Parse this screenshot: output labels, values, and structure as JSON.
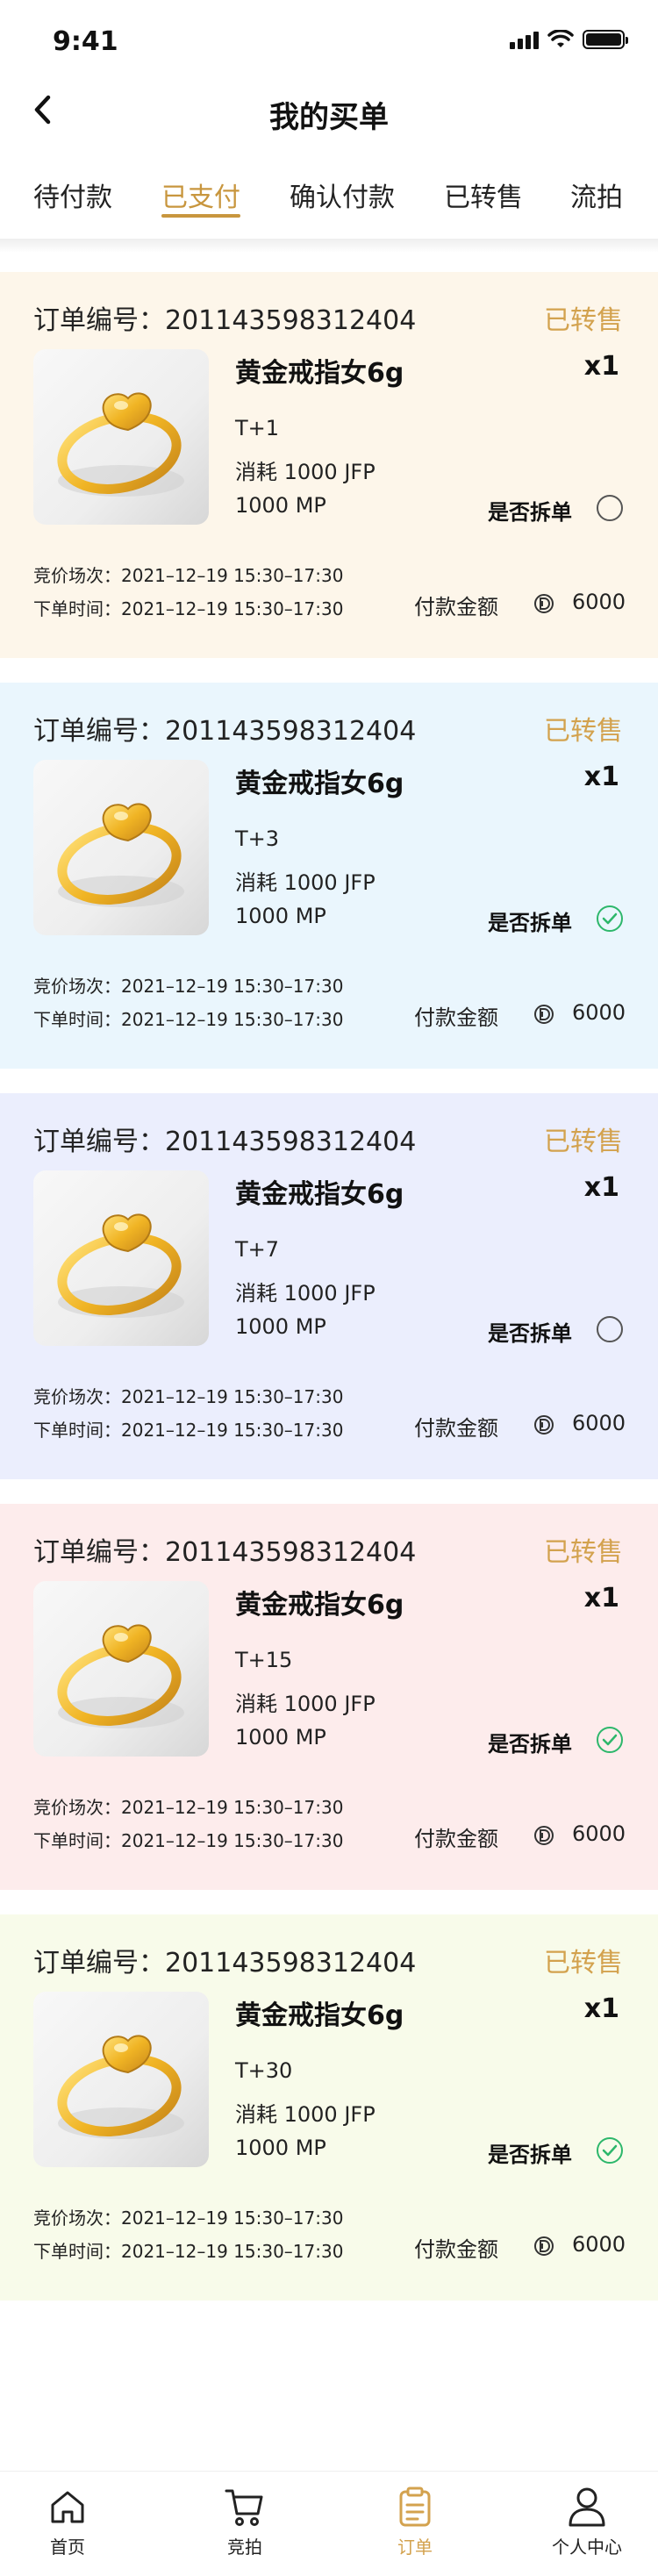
{
  "status_bar": {
    "time": "9:41"
  },
  "header": {
    "title": "我的买单"
  },
  "tabs": [
    {
      "label": "待付款",
      "active": false
    },
    {
      "label": "已支付",
      "active": true
    },
    {
      "label": "确认付款",
      "active": false
    },
    {
      "label": "已转售",
      "active": false
    },
    {
      "label": "流拍",
      "active": false
    }
  ],
  "colors": {
    "accent": "#c8963e",
    "status": "#d3a24e",
    "check": "#2db76b"
  },
  "orders": [
    {
      "order_label": "订单编号：201143598312404",
      "status": "已转售",
      "product": "黄金戒指女6g",
      "qty": "x1",
      "t": "T+1",
      "consume": "消耗 1000 JFP",
      "mp": "1000 MP",
      "split_label": "是否拆单",
      "split_checked": false,
      "session": "竞价场次：2021–12–19 15:30–17:30",
      "order_time": "下单时间：2021–12–19 15:30–17:30",
      "pay_label": "付款金额",
      "pay_amount": "6000",
      "bg": "#fdf6ea"
    },
    {
      "order_label": "订单编号：201143598312404",
      "status": "已转售",
      "product": "黄金戒指女6g",
      "qty": "x1",
      "t": "T+3",
      "consume": "消耗 1000 JFP",
      "mp": "1000 MP",
      "split_label": "是否拆单",
      "split_checked": true,
      "session": "竞价场次：2021–12–19 15:30–17:30",
      "order_time": "下单时间：2021–12–19 15:30–17:30",
      "pay_label": "付款金额",
      "pay_amount": "6000",
      "bg": "#eaf6fd"
    },
    {
      "order_label": "订单编号：201143598312404",
      "status": "已转售",
      "product": "黄金戒指女6g",
      "qty": "x1",
      "t": "T+7",
      "consume": "消耗 1000 JFP",
      "mp": "1000 MP",
      "split_label": "是否拆单",
      "split_checked": false,
      "session": "竞价场次：2021–12–19 15:30–17:30",
      "order_time": "下单时间：2021–12–19 15:30–17:30",
      "pay_label": "付款金额",
      "pay_amount": "6000",
      "bg": "#ebeefd"
    },
    {
      "order_label": "订单编号：201143598312404",
      "status": "已转售",
      "product": "黄金戒指女6g",
      "qty": "x1",
      "t": "T+15",
      "consume": "消耗 1000 JFP",
      "mp": "1000 MP",
      "split_label": "是否拆单",
      "split_checked": true,
      "session": "竞价场次：2021–12–19 15:30–17:30",
      "order_time": "下单时间：2021–12–19 15:30–17:30",
      "pay_label": "付款金额",
      "pay_amount": "6000",
      "bg": "#fdecec"
    },
    {
      "order_label": "订单编号：201143598312404",
      "status": "已转售",
      "product": "黄金戒指女6g",
      "qty": "x1",
      "t": "T+30",
      "consume": "消耗 1000 JFP",
      "mp": "1000 MP",
      "split_label": "是否拆单",
      "split_checked": true,
      "session": "竞价场次：2021–12–19 15:30–17:30",
      "order_time": "下单时间：2021–12–19 15:30–17:30",
      "pay_label": "付款金额",
      "pay_amount": "6000",
      "bg": "#f8fbea"
    }
  ],
  "tabbar": [
    {
      "label": "首页",
      "icon": "home-icon",
      "active": false
    },
    {
      "label": "竞拍",
      "icon": "cart-icon",
      "active": false
    },
    {
      "label": "订单",
      "icon": "clipboard-icon",
      "active": true
    },
    {
      "label": "个人中心",
      "icon": "person-icon",
      "active": false
    }
  ]
}
